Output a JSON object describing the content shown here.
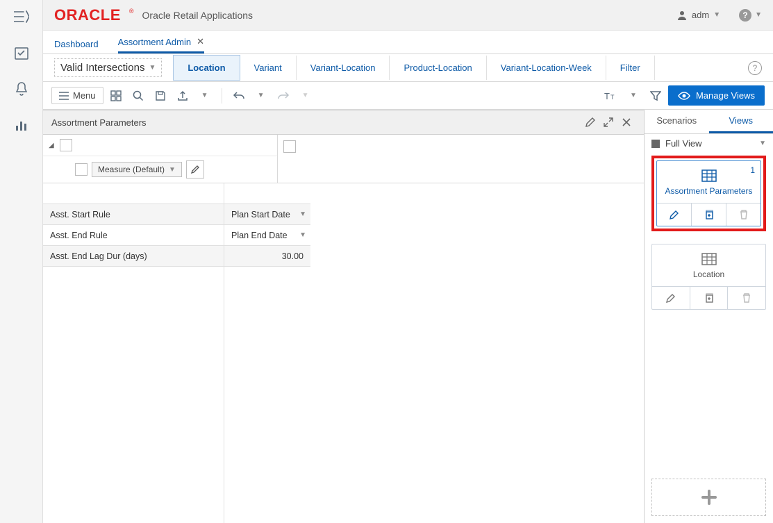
{
  "header": {
    "logo": "ORACLE",
    "app_title": "Oracle Retail Applications",
    "user": "adm"
  },
  "tabs": {
    "dashboard": "Dashboard",
    "assortment_admin": "Assortment Admin"
  },
  "subhead": {
    "dropdown": "Valid Intersections",
    "subtabs": [
      "Location",
      "Variant",
      "Variant-Location",
      "Product-Location",
      "Variant-Location-Week",
      "Filter"
    ]
  },
  "toolbar": {
    "menu_label": "Menu",
    "manage_views": "Manage Views"
  },
  "panel": {
    "title": "Assortment Parameters",
    "measure_chip": "Measure (Default)"
  },
  "grid": {
    "rows": [
      {
        "label": "Asst. Start Rule",
        "value": "Plan Start Date",
        "type": "select"
      },
      {
        "label": "Asst. End Rule",
        "value": "Plan End Date",
        "type": "select"
      },
      {
        "label": "Asst. End Lag Dur (days)",
        "value": "30.00",
        "type": "number"
      }
    ]
  },
  "sidepanel": {
    "tab_scenarios": "Scenarios",
    "tab_views": "Views",
    "full_view": "Full View",
    "card1": {
      "badge": "1",
      "label": "Assortment Parameters"
    },
    "card2": {
      "label": "Location"
    }
  }
}
